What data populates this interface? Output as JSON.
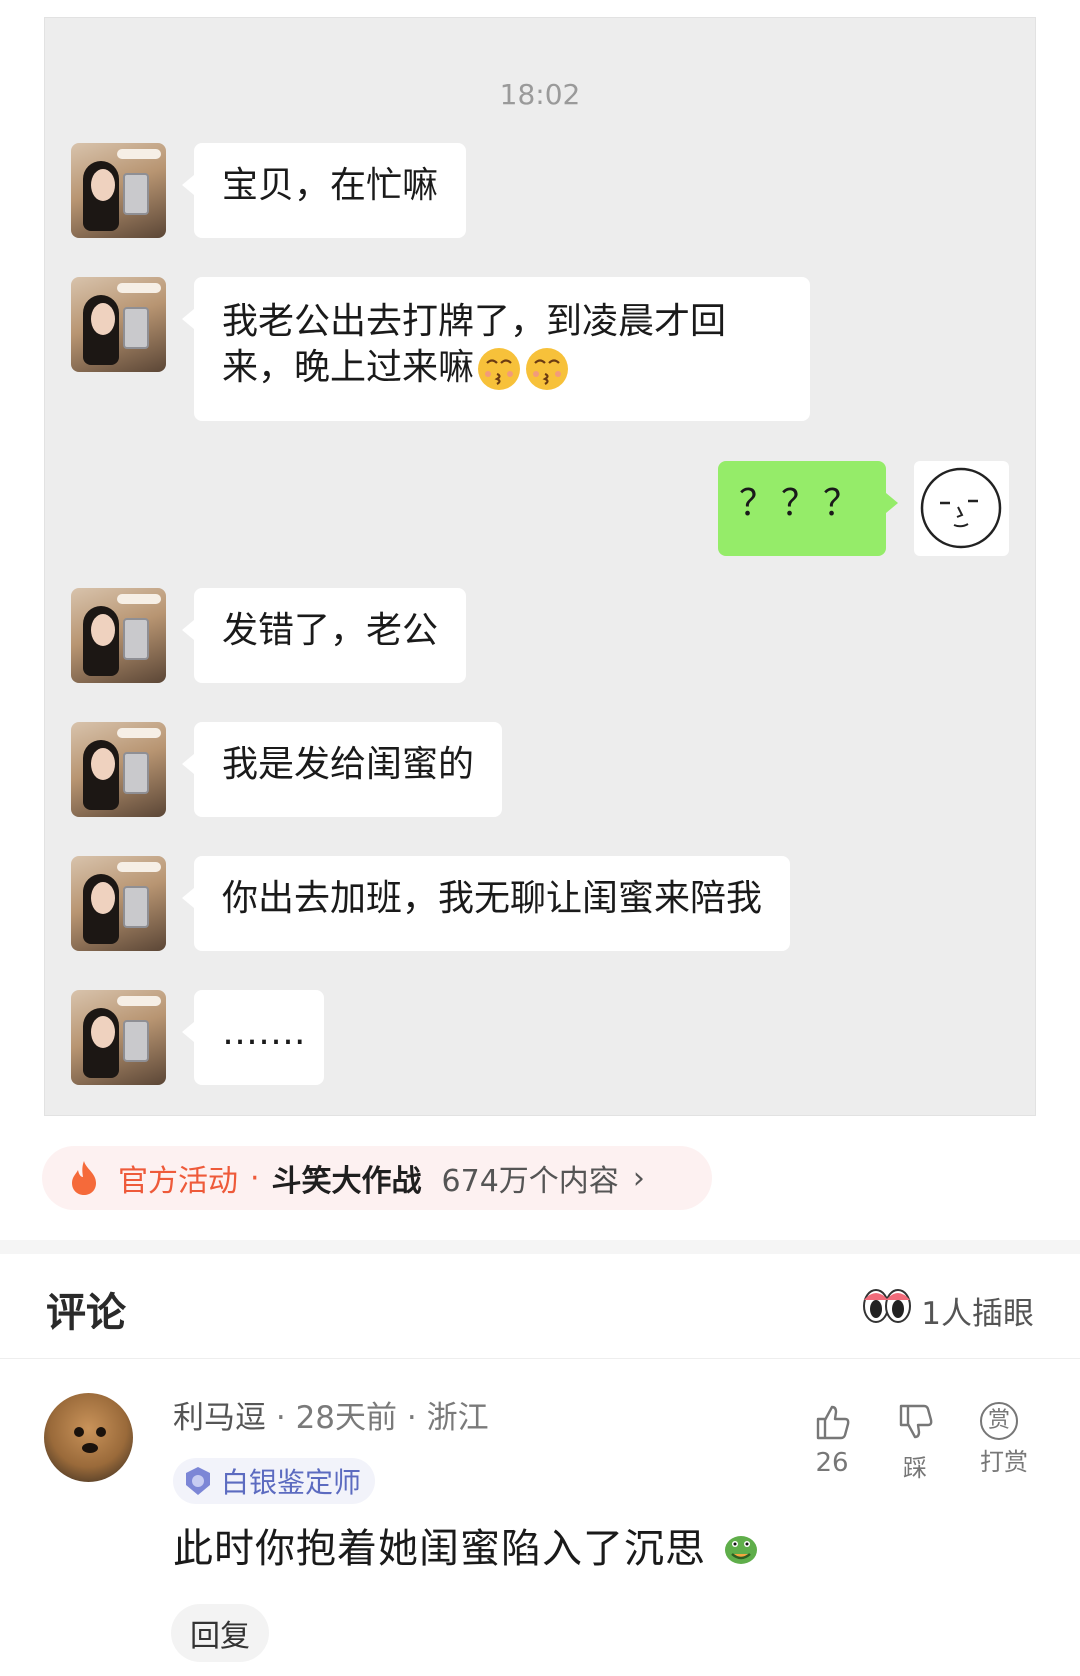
{
  "chat": {
    "time": "18:02",
    "messages": [
      {
        "text": "宝贝，在忙嘛"
      },
      {
        "line1": "我老公出去打牌了，到凌晨才回",
        "line2": "来，晚上过来嘛"
      },
      {
        "text": "？？？"
      },
      {
        "text": "发错了，老公"
      },
      {
        "text": "我是发给闺蜜的"
      },
      {
        "text": "你出去加班，我无聊让闺蜜来陪我"
      },
      {
        "text": "……."
      }
    ]
  },
  "activity": {
    "tag": "官方活动",
    "separator": "·",
    "name": "斗笑大作战",
    "count": "674万个内容",
    "chevron": "›",
    "accent": "#ee5a3a"
  },
  "comments": {
    "title": "评论",
    "peek_text": "1人插眼",
    "items": [
      {
        "user": "利马逗",
        "meta": "· 28天前 · 浙江",
        "badge": "白银鉴定师",
        "text": "此时你抱着她闺蜜陷入了沉思",
        "likes": "26",
        "dislike_label": "踩",
        "reward_label": "打赏",
        "reward_icon_text": "赏",
        "reply_label": "回复"
      }
    ]
  },
  "colors": {
    "chat_bg": "#ededed",
    "outgoing_bubble": "#95ec69",
    "badge_text": "#5c6bc0"
  }
}
